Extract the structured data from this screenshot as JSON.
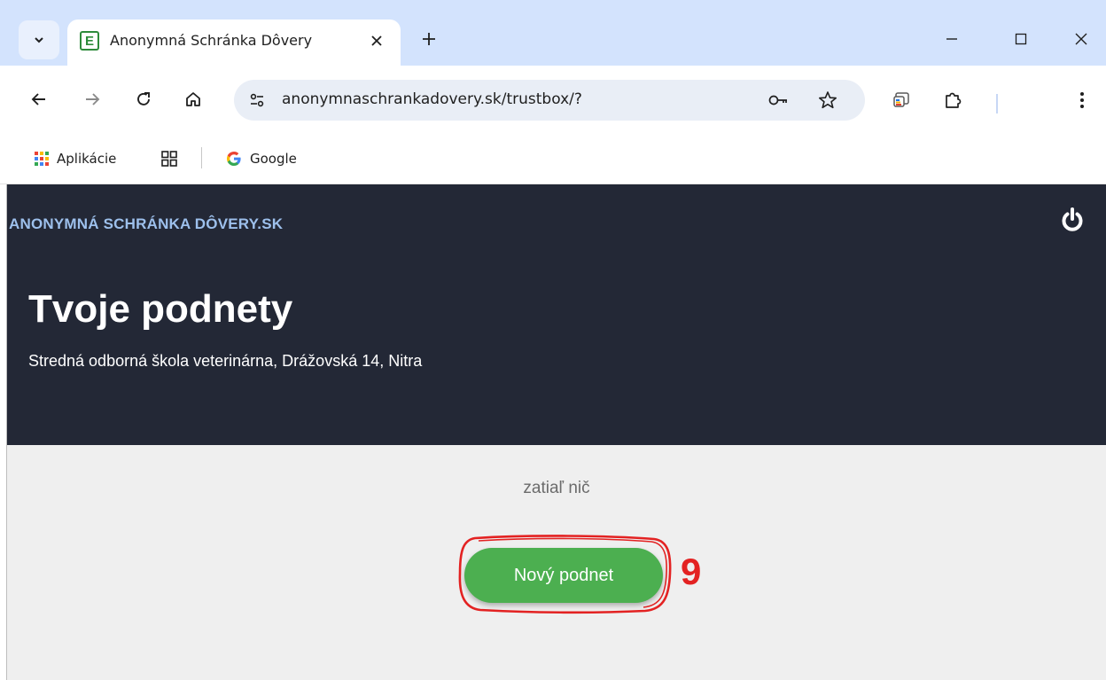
{
  "browser": {
    "tab": {
      "title": "Anonymná Schránka Dôvery",
      "favicon_letter": "E"
    },
    "url": "anonymnaschrankadovery.sk/trustbox/?",
    "bookmarks": [
      {
        "label": "Aplikácie",
        "icon": "apps-grid-icon"
      },
      {
        "label": "",
        "icon": "tab-groups-icon"
      },
      {
        "label": "Google",
        "icon": "google-icon"
      }
    ]
  },
  "page": {
    "brand": "ANONYMNÁ SCHRÁNKA DÔVERY.SK",
    "heading": "Tvoje podnety",
    "subheading": "Stredná odborná škola veterinárna, Drážovská 14, Nitra",
    "empty_text": "zatiaľ nič",
    "new_button": "Nový podnet",
    "annotation_number": "9"
  },
  "colors": {
    "hero_bg": "#232836",
    "brand": "#9dc0ec",
    "button": "#4caf50",
    "annotation": "#e32222",
    "content_bg": "#efefef"
  }
}
